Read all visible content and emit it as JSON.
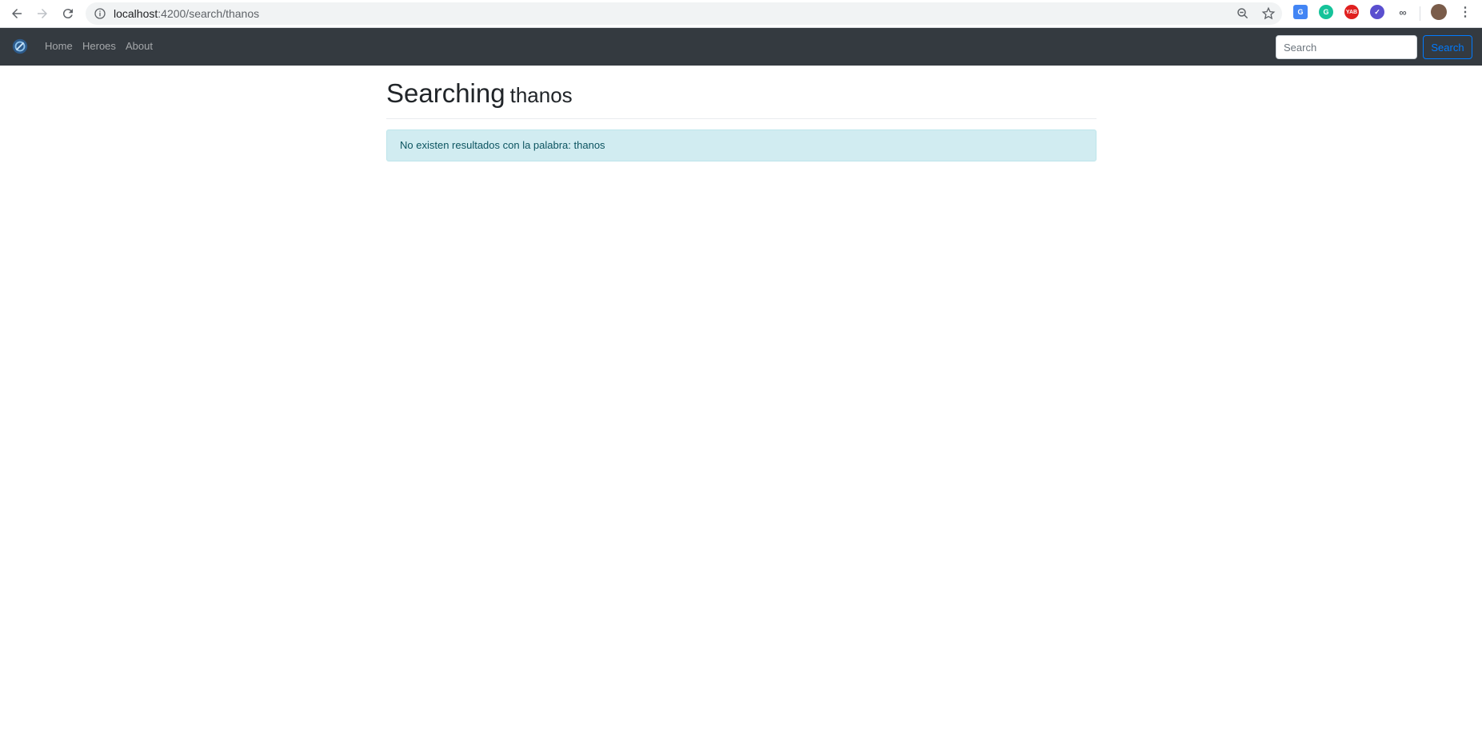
{
  "browser": {
    "url_host": "localhost",
    "url_path": ":4200/search/thanos"
  },
  "navbar": {
    "links": [
      {
        "label": "Home"
      },
      {
        "label": "Heroes"
      },
      {
        "label": "About"
      }
    ],
    "search_placeholder": "Search",
    "search_button": "Search"
  },
  "main": {
    "title": "Searching",
    "term": "thanos",
    "alert": "No existen resultados con la palabra: thanos"
  }
}
